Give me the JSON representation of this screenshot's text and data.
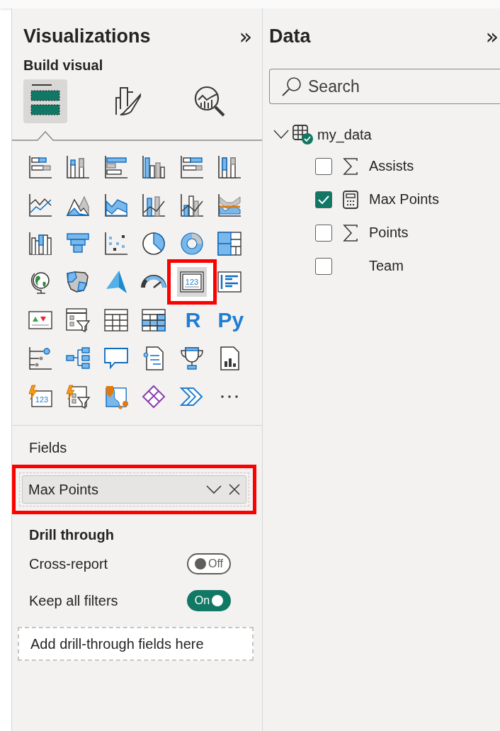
{
  "visualizations": {
    "title": "Visualizations",
    "collapse": "»",
    "build_visual": {
      "title": "Build visual",
      "tabs": [
        {
          "selected": true
        },
        {
          "selected": false
        },
        {
          "selected": false
        }
      ]
    },
    "visuals": [
      {
        "kind": "stackedbar",
        "selected": false
      },
      {
        "kind": "stackedcolumn",
        "selected": false
      },
      {
        "kind": "clusteredbar",
        "selected": false
      },
      {
        "kind": "clusteredcolumn",
        "selected": false
      },
      {
        "kind": "fullbar",
        "selected": false
      },
      {
        "kind": "fullcolumn",
        "selected": false
      },
      {
        "kind": "line",
        "selected": false
      },
      {
        "kind": "area",
        "selected": false
      },
      {
        "kind": "stackedarea",
        "selected": false
      },
      {
        "kind": "linecolumn",
        "selected": false
      },
      {
        "kind": "lineclustered",
        "selected": false
      },
      {
        "kind": "ribbon",
        "selected": false
      },
      {
        "kind": "waterfall",
        "selected": false
      },
      {
        "kind": "funnel",
        "selected": false
      },
      {
        "kind": "scatter",
        "selected": false
      },
      {
        "kind": "pie",
        "selected": false
      },
      {
        "kind": "donut",
        "selected": false
      },
      {
        "kind": "treemap",
        "selected": false
      },
      {
        "kind": "globe",
        "selected": false
      },
      {
        "kind": "filledmap",
        "selected": false
      },
      {
        "kind": "azuremap",
        "selected": false
      },
      {
        "kind": "gauge",
        "selected": false
      },
      {
        "kind": "card",
        "selected": true,
        "label": "123"
      },
      {
        "kind": "multirowcard",
        "selected": false
      },
      {
        "kind": "kpi",
        "selected": false
      },
      {
        "kind": "slicer",
        "selected": false
      },
      {
        "kind": "table",
        "selected": false
      },
      {
        "kind": "matrix",
        "selected": false
      },
      {
        "kind": "rscript",
        "selected": false,
        "label": "R"
      },
      {
        "kind": "python",
        "selected": false,
        "label": "Py"
      },
      {
        "kind": "influencers",
        "selected": false
      },
      {
        "kind": "decomposition",
        "selected": false
      },
      {
        "kind": "qna",
        "selected": false
      },
      {
        "kind": "narrative",
        "selected": false
      },
      {
        "kind": "goals",
        "selected": false
      },
      {
        "kind": "paginated",
        "selected": false
      },
      {
        "kind": "appscard",
        "selected": false,
        "label": "123"
      },
      {
        "kind": "appsslicer",
        "selected": false
      },
      {
        "kind": "arcgis",
        "selected": false
      },
      {
        "kind": "powerapps",
        "selected": false
      },
      {
        "kind": "automate",
        "selected": false
      },
      {
        "kind": "more",
        "selected": false
      }
    ],
    "fields": {
      "title": "Fields",
      "highlighted": true,
      "value": "Max Points"
    },
    "drill_through": {
      "title": "Drill through",
      "options": [
        {
          "label": "Cross-report",
          "on": false,
          "state_label": "Off"
        },
        {
          "label": "Keep all filters",
          "on": true,
          "state_label": "On"
        }
      ],
      "placeholder": "Add drill-through fields here"
    }
  },
  "data": {
    "title": "Data",
    "collapse": "»",
    "search": {
      "placeholder": "Search"
    },
    "table": {
      "name": "my_data",
      "expanded": true,
      "children": [
        {
          "label": "Assists",
          "kind": "sum",
          "checked": false
        },
        {
          "label": "Max Points",
          "kind": "measure",
          "checked": true
        },
        {
          "label": "Points",
          "kind": "sum",
          "checked": false
        },
        {
          "label": "Team",
          "kind": "text",
          "checked": false
        }
      ]
    }
  }
}
